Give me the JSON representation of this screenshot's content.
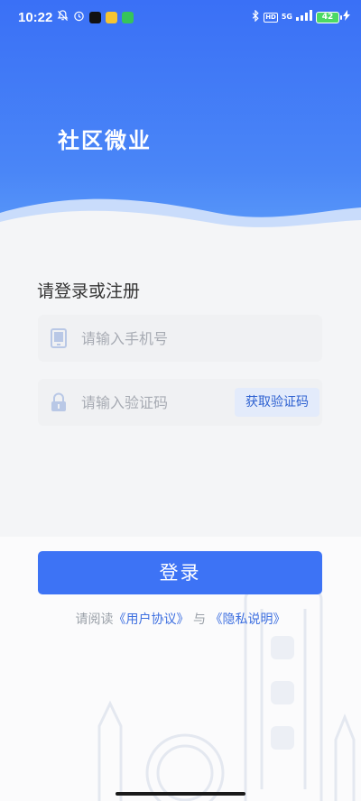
{
  "status_bar": {
    "time": "10:22",
    "network": "5G",
    "battery": "42",
    "hd_badge": "HD"
  },
  "header": {
    "title": "社区微业"
  },
  "form": {
    "heading": "请登录或注册",
    "phone_placeholder": "请输入手机号",
    "code_placeholder": "请输入验证码",
    "get_code_label": "获取验证码"
  },
  "actions": {
    "login_label": "登录"
  },
  "agreement": {
    "prefix": "请阅读",
    "user_agreement": "《用户协议》",
    "conjunction": "与",
    "privacy": "《隐私说明》"
  },
  "colors": {
    "brand_blue": "#3d73f5",
    "header_gradient_top": "#3a70f6",
    "link": "#3d6fe0"
  },
  "icons": {
    "phone_field": "phone-icon",
    "code_field": "lock-icon"
  }
}
